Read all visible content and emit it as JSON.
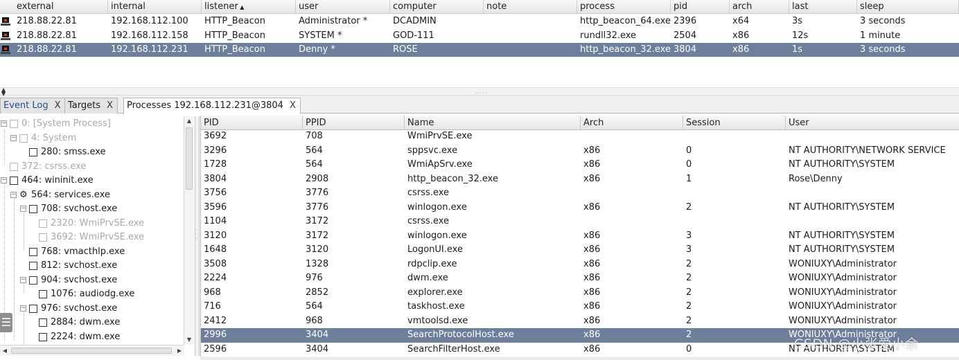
{
  "beacons": {
    "columns": [
      "external",
      "internal",
      "listener",
      "user",
      "computer",
      "note",
      "process",
      "pid",
      "arch",
      "last",
      "sleep"
    ],
    "sort_indicator": "▲",
    "rows": [
      {
        "external": "218.88.22.81",
        "internal": "192.168.112.100",
        "listener": "HTTP_Beacon",
        "user": "Administrator *",
        "computer": "DCADMIN",
        "note": "",
        "process": "http_beacon_64.exe",
        "pid": "2396",
        "arch": "x64",
        "last": "3s",
        "sleep": "3 seconds",
        "selected": false
      },
      {
        "external": "218.88.22.81",
        "internal": "192.168.112.158",
        "listener": "HTTP_Beacon",
        "user": "SYSTEM *",
        "computer": "GOD-111",
        "note": "",
        "process": "rundll32.exe",
        "pid": "2504",
        "arch": "x86",
        "last": "12s",
        "sleep": "1 minute",
        "selected": false
      },
      {
        "external": "218.88.22.81",
        "internal": "192.168.112.231",
        "listener": "HTTP_Beacon",
        "user": "Denny *",
        "computer": "ROSE",
        "note": "",
        "process": "http_beacon_32.exe",
        "pid": "3804",
        "arch": "x86",
        "last": "1s",
        "sleep": "3 seconds",
        "selected": true
      }
    ]
  },
  "tabs": [
    {
      "label": "Event Log",
      "close": "X",
      "active": false
    },
    {
      "label": "Targets",
      "close": "X",
      "active": false
    },
    {
      "label": "Processes 192.168.112.231@3804",
      "close": "X",
      "active": true
    }
  ],
  "tree": [
    {
      "label": "0: [System Process]",
      "level": 0,
      "expander": "minus",
      "icon": "box",
      "dim": true
    },
    {
      "label": "4: System",
      "level": 1,
      "expander": "minus",
      "icon": "box",
      "dim": true
    },
    {
      "label": "280: smss.exe",
      "level": 2,
      "expander": "",
      "icon": "box",
      "dim": false
    },
    {
      "label": "372: csrss.exe",
      "level": 0,
      "expander": "",
      "icon": "box",
      "dim": true
    },
    {
      "label": "464: wininit.exe",
      "level": 0,
      "expander": "minus",
      "icon": "box",
      "dim": false
    },
    {
      "label": "564: services.exe",
      "level": 1,
      "expander": "minus",
      "icon": "gear",
      "dim": false
    },
    {
      "label": "708: svchost.exe",
      "level": 2,
      "expander": "minus",
      "icon": "box",
      "dim": false
    },
    {
      "label": "2320: WmiPrvSE.exe",
      "level": 3,
      "expander": "",
      "icon": "box",
      "dim": true
    },
    {
      "label": "3692: WmiPrvSE.exe",
      "level": 3,
      "expander": "",
      "icon": "box",
      "dim": true
    },
    {
      "label": "768: vmacthlp.exe",
      "level": 2,
      "expander": "",
      "icon": "box",
      "dim": false
    },
    {
      "label": "812: svchost.exe",
      "level": 2,
      "expander": "",
      "icon": "box",
      "dim": false
    },
    {
      "label": "904: svchost.exe",
      "level": 2,
      "expander": "minus",
      "icon": "box",
      "dim": false
    },
    {
      "label": "1076: audiodg.exe",
      "level": 3,
      "expander": "",
      "icon": "box",
      "dim": false
    },
    {
      "label": "976: svchost.exe",
      "level": 2,
      "expander": "minus",
      "icon": "box",
      "dim": false
    },
    {
      "label": "2884: dwm.exe",
      "level": 3,
      "expander": "",
      "icon": "box",
      "dim": false
    },
    {
      "label": "2224: dwm.exe",
      "level": 3,
      "expander": "",
      "icon": "box",
      "dim": false
    }
  ],
  "processes": {
    "columns": [
      "PID",
      "PPID",
      "Name",
      "Arch",
      "Session",
      "User"
    ],
    "rows": [
      {
        "pid": "3692",
        "ppid": "708",
        "name": "WmiPrvSE.exe",
        "arch": "",
        "session": "",
        "user": "",
        "selected": false
      },
      {
        "pid": "3296",
        "ppid": "564",
        "name": "sppsvc.exe",
        "arch": "x86",
        "session": "0",
        "user": "NT AUTHORITY\\NETWORK SERVICE",
        "selected": false
      },
      {
        "pid": "1728",
        "ppid": "564",
        "name": "WmiApSrv.exe",
        "arch": "x86",
        "session": "0",
        "user": "NT AUTHORITY\\SYSTEM",
        "selected": false
      },
      {
        "pid": "3804",
        "ppid": "2908",
        "name": "http_beacon_32.exe",
        "arch": "x86",
        "session": "1",
        "user": "Rose\\Denny",
        "selected": false
      },
      {
        "pid": "3756",
        "ppid": "3776",
        "name": "csrss.exe",
        "arch": "",
        "session": "",
        "user": "",
        "selected": false
      },
      {
        "pid": "3596",
        "ppid": "3776",
        "name": "winlogon.exe",
        "arch": "x86",
        "session": "2",
        "user": "NT AUTHORITY\\SYSTEM",
        "selected": false
      },
      {
        "pid": "1104",
        "ppid": "3172",
        "name": "csrss.exe",
        "arch": "",
        "session": "",
        "user": "",
        "selected": false
      },
      {
        "pid": "3120",
        "ppid": "3172",
        "name": "winlogon.exe",
        "arch": "x86",
        "session": "3",
        "user": "NT AUTHORITY\\SYSTEM",
        "selected": false
      },
      {
        "pid": "1648",
        "ppid": "3120",
        "name": "LogonUI.exe",
        "arch": "x86",
        "session": "3",
        "user": "NT AUTHORITY\\SYSTEM",
        "selected": false
      },
      {
        "pid": "3508",
        "ppid": "1328",
        "name": "rdpclip.exe",
        "arch": "x86",
        "session": "2",
        "user": "WONIUXY\\Administrator",
        "selected": false
      },
      {
        "pid": "2224",
        "ppid": "976",
        "name": "dwm.exe",
        "arch": "x86",
        "session": "2",
        "user": "WONIUXY\\Administrator",
        "selected": false
      },
      {
        "pid": "968",
        "ppid": "2852",
        "name": "explorer.exe",
        "arch": "x86",
        "session": "2",
        "user": "WONIUXY\\Administrator",
        "selected": false
      },
      {
        "pid": "716",
        "ppid": "564",
        "name": "taskhost.exe",
        "arch": "x86",
        "session": "2",
        "user": "WONIUXY\\Administrator",
        "selected": false
      },
      {
        "pid": "2412",
        "ppid": "968",
        "name": "vmtoolsd.exe",
        "arch": "x86",
        "session": "2",
        "user": "WONIUXY\\Administrator",
        "selected": false
      },
      {
        "pid": "2996",
        "ppid": "3404",
        "name": "SearchProtocolHost.exe",
        "arch": "x86",
        "session": "2",
        "user": "WONIUXY\\Administrator",
        "selected": true
      },
      {
        "pid": "2596",
        "ppid": "3404",
        "name": "SearchFilterHost.exe",
        "arch": "x86",
        "session": "0",
        "user": "NT AUTHORITY\\SYSTEM",
        "selected": false
      }
    ]
  },
  "watermark": "CSDN @小张爱小余",
  "colors": {
    "selection": "#6e7f9b",
    "header": "#e6e6e6",
    "dim_text": "#a8a8a8"
  },
  "icons": {
    "beacon": "monitor-icon",
    "tree_node": "checkbox-icon",
    "service": "gear-icon",
    "pane_handle": "menu-icon"
  }
}
